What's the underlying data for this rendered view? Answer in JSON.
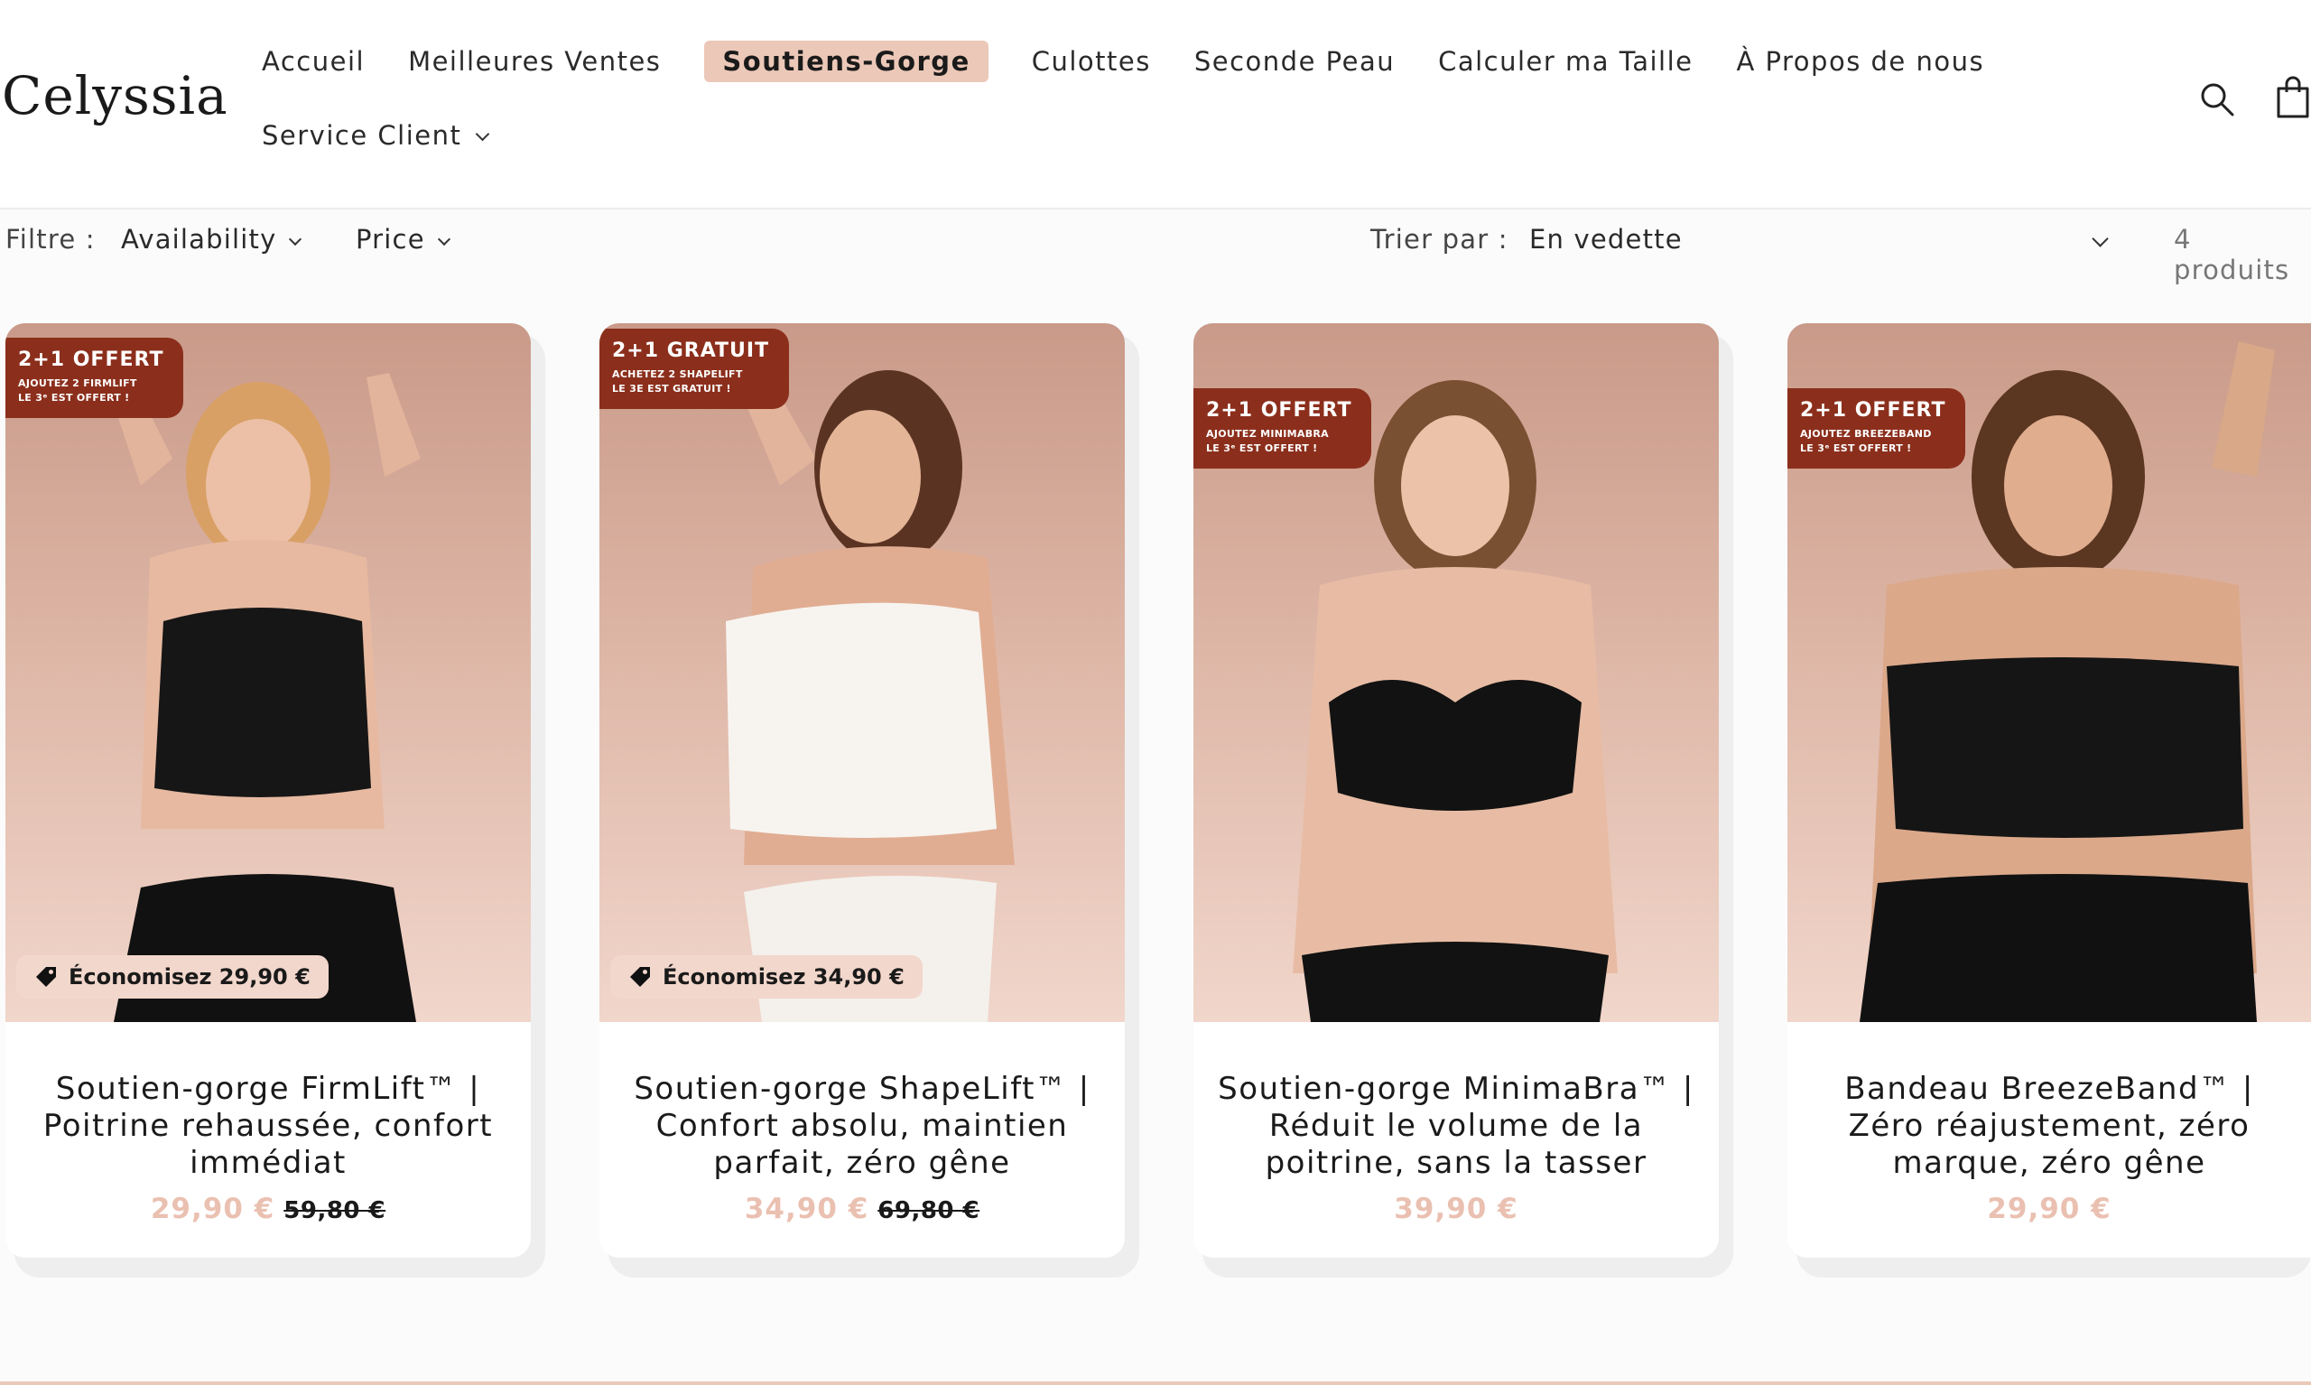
{
  "brand": {
    "logo": "Celyssia"
  },
  "nav": {
    "row1": [
      "Accueil",
      "Meilleures Ventes",
      "Soutiens-Gorge",
      "Culottes",
      "Seconde Peau",
      "Calculer ma Taille",
      "À Propos de nous"
    ],
    "active": "Soutiens-Gorge",
    "service": "Service Client"
  },
  "header_icons": [
    "search-icon",
    "shopping-bag-icon"
  ],
  "filters": {
    "label": "Filtre :",
    "availability": "Availability",
    "price": "Price",
    "sort_label": "Trier par :",
    "sort_value": "En vedette",
    "count": "4 produits"
  },
  "colors": {
    "accent": "#ecc8b8",
    "promo_badge": "#8b2f1c",
    "price": "#eac0b1"
  },
  "products": [
    {
      "promo_title": "2+1 OFFERT",
      "promo_line1": "AJOUTEZ 2 FIRMLIFT",
      "promo_line2": "LE 3ᵉ EST OFFERT !",
      "save": "Économisez 29,90 €",
      "title": "Soutien-gorge FirmLift™ | Poitrine rehaussée, confort immédiat",
      "price": "29,90 €",
      "old_price": "59,80 €"
    },
    {
      "promo_title": "2+1 GRATUIT",
      "promo_line1": "ACHETEZ 2 SHAPELIFT",
      "promo_line2": "LE 3E EST GRATUIT !",
      "save": "Économisez 34,90 €",
      "title": "Soutien-gorge ShapeLift™ | Confort absolu, maintien parfait, zéro gêne",
      "price": "34,90 €",
      "old_price": "69,80 €"
    },
    {
      "promo_title": "2+1 OFFERT",
      "promo_line1": "AJOUTEZ MINIMABRA",
      "promo_line2": "LE 3ᵉ EST OFFERT !",
      "title": "Soutien-gorge MinimaBra™ | Réduit le volume de la poitrine, sans la tasser",
      "price": "39,90 €"
    },
    {
      "promo_title": "2+1 OFFERT",
      "promo_line1": "AJOUTEZ BREEZEBAND",
      "promo_line2": "LE 3ᵉ EST OFFERT !",
      "title": "Bandeau BreezeBand™ | Zéro réajustement, zéro marque, zéro gêne",
      "price": "29,90 €"
    }
  ]
}
